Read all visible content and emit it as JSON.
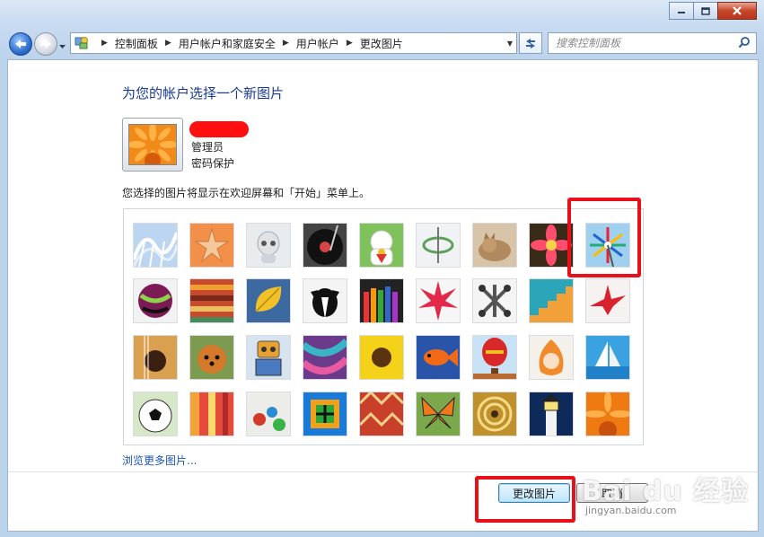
{
  "window": {
    "controls": [
      "minimize",
      "maximize",
      "close"
    ]
  },
  "nav": {
    "breadcrumbs": [
      "控制面板",
      "用户帐户和家庭安全",
      "用户帐户",
      "更改图片"
    ],
    "search_placeholder": "搜索控制面板"
  },
  "page": {
    "title": "为您的帐户选择一个新图片",
    "account_role": "管理员",
    "account_status": "密码保护",
    "hint": "您选择的图片将显示在欢迎屏幕和「开始」菜单上。",
    "browse_link": "浏览更多图片...",
    "change_button": "更改图片",
    "cancel_button": "取消"
  },
  "pictures": [
    "roller-coaster",
    "starfish",
    "robot-toy",
    "record-player",
    "lucky-cat",
    "spinning-top",
    "kitten",
    "pink-flower",
    "pinwheel",
    "ball",
    "fabric-rolls",
    "yellow-leaf",
    "dog",
    "crayons",
    "red-star",
    "jacks",
    "stairs",
    "paper-crane",
    "guitar",
    "pomeranian",
    "tin-robot",
    "silk-scarf",
    "sunflower",
    "goldfish",
    "hot-air-balloon",
    "doll",
    "sailboat",
    "soccer-ball",
    "textiles",
    "marbles",
    "window-frame",
    "woven-pattern",
    "butterfly",
    "spiral-shell",
    "lighthouse",
    "orange-daisy"
  ],
  "selected_picture": "pinwheel",
  "watermark": {
    "brand": "Bai du 经验",
    "url": "jingyan.baidu.com"
  }
}
